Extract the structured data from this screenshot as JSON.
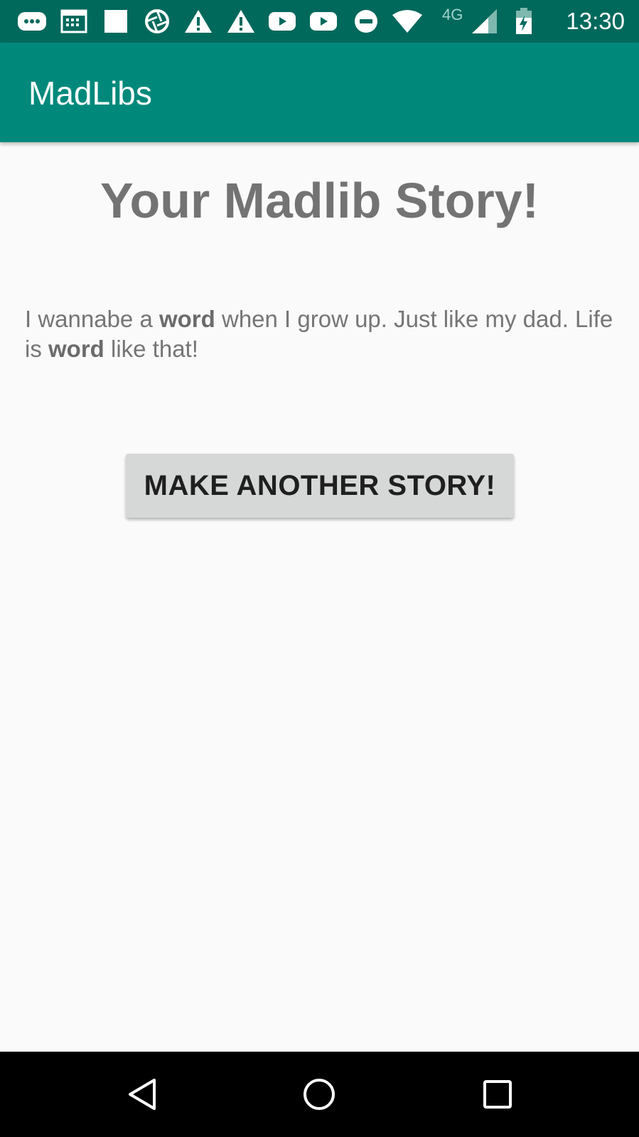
{
  "status_bar": {
    "time": "13:30",
    "network_label": "4G",
    "icons": [
      "messaging-icon",
      "calendar-icon",
      "square-notification-icon",
      "aperture-icon",
      "warning-icon",
      "warning-icon",
      "youtube-icon",
      "youtube-icon",
      "do-not-disturb-icon",
      "wifi-icon",
      "cell-signal-icon",
      "battery-charging-icon"
    ],
    "background_color": "#00695c"
  },
  "app_bar": {
    "title": "MadLibs",
    "background_color": "#00897b"
  },
  "main": {
    "heading": "Your Madlib Story!",
    "story": {
      "part1": "I wannabe a ",
      "word1": "word",
      "part2": " when I grow up. Just like my dad. Life is ",
      "word2": "word",
      "part3": " like that!"
    },
    "button_label": "MAKE ANOTHER STORY!"
  },
  "nav_bar": {
    "back": "back-icon",
    "home": "home-icon",
    "recents": "recents-icon"
  }
}
